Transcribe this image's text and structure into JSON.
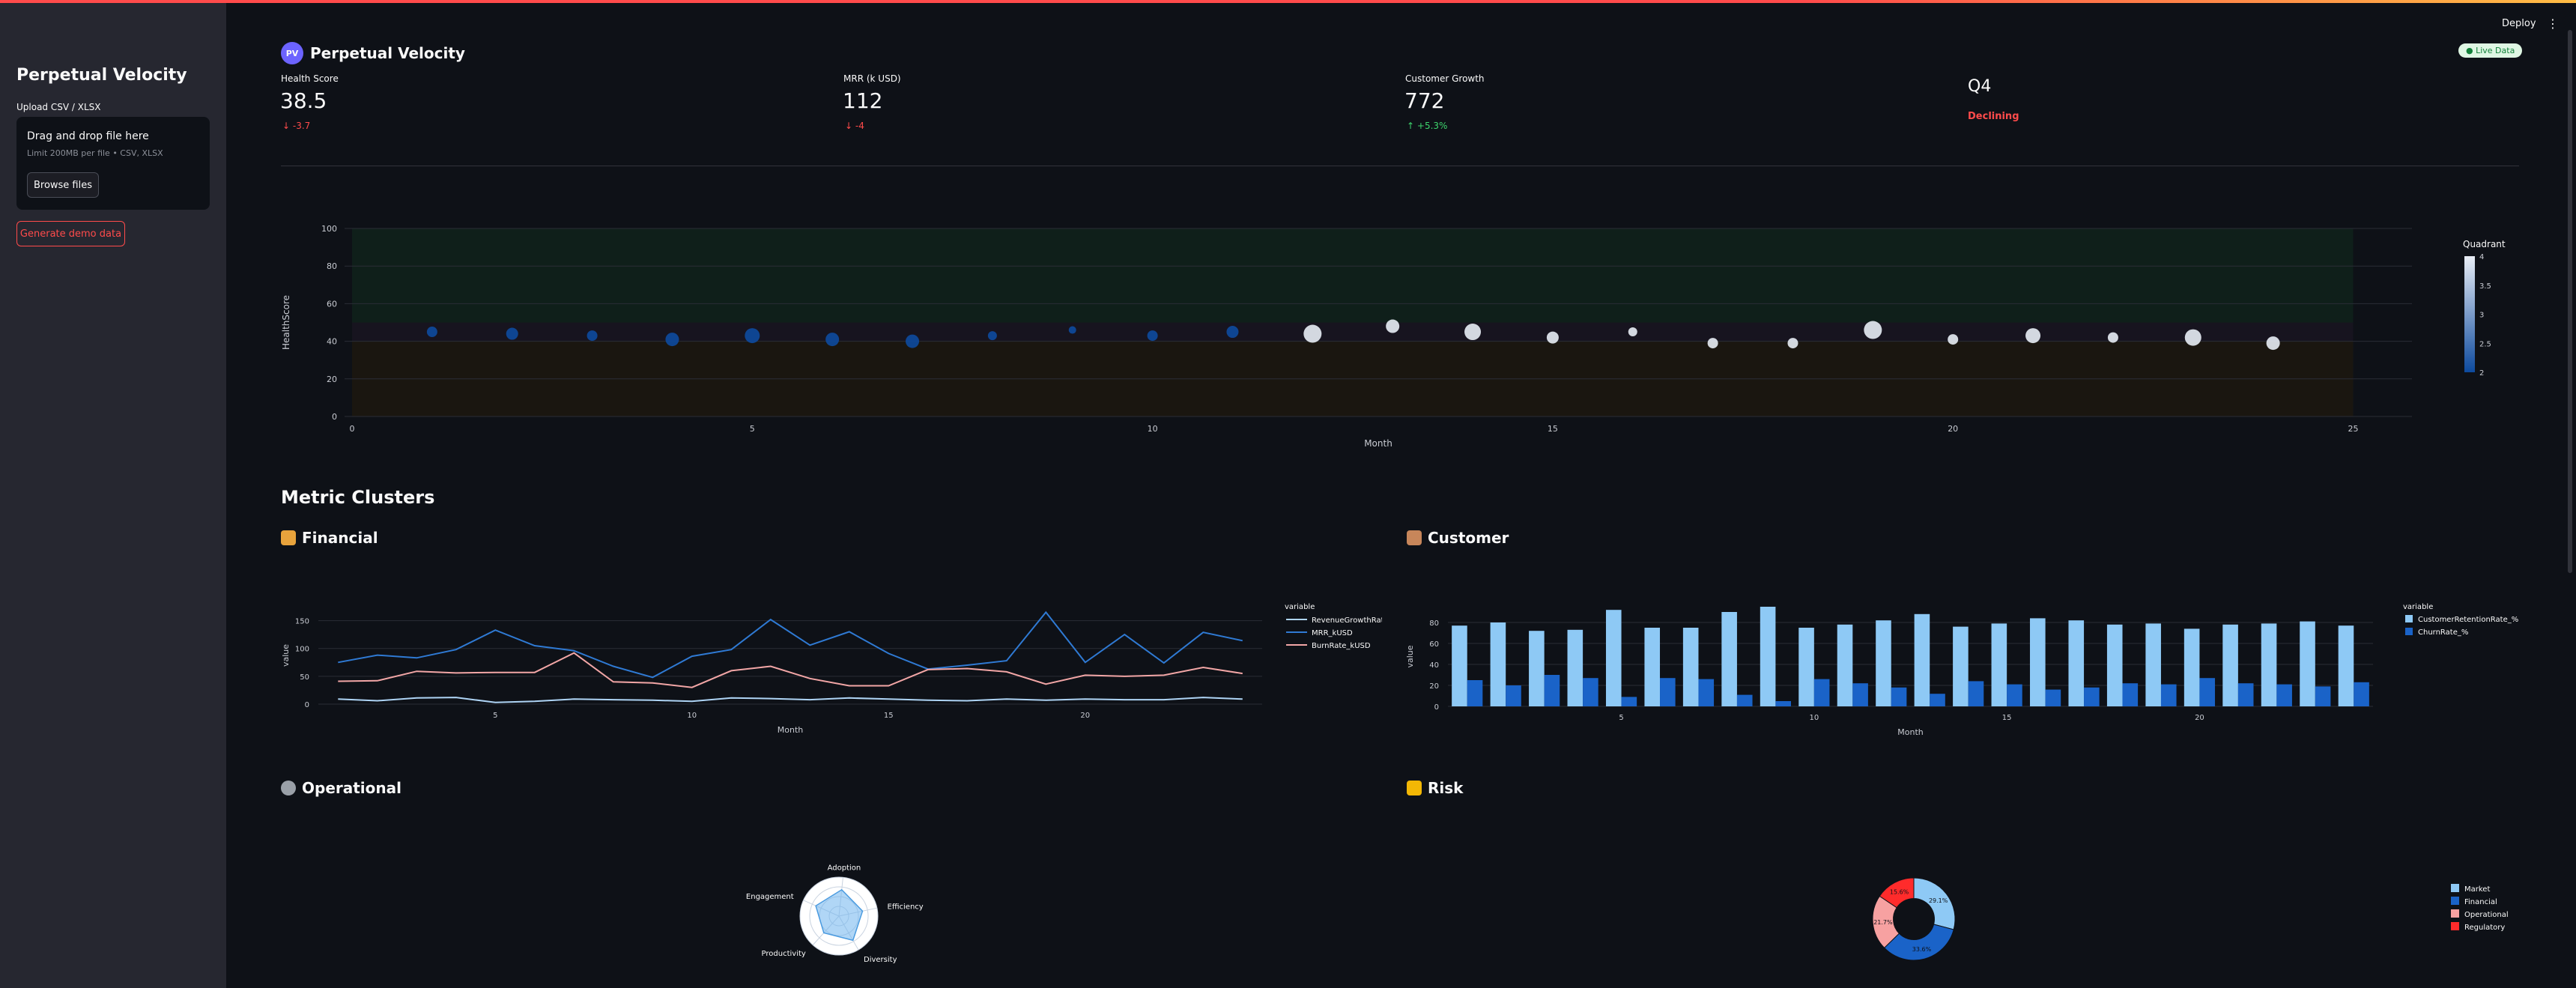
{
  "app": {
    "title": "Perpetual Velocity",
    "logo_text": "PV",
    "live_badge": "● Live Data",
    "deploy_label": "Deploy",
    "menu_icon": "kebab-menu-icon"
  },
  "sidebar": {
    "title": "Perpetual Velocity",
    "upload_label": "Upload CSV / XLSX",
    "drop_text": "Drag and drop file here",
    "limit_text": "Limit 200MB per file • CSV, XLSX",
    "browse_label": "Browse files",
    "demo_label": "Generate demo data"
  },
  "metrics": [
    {
      "label": "Health Score",
      "value": "38.5",
      "delta": "-3.7",
      "direction": "down"
    },
    {
      "label": "MRR (k USD)",
      "value": "112",
      "delta": "-4",
      "direction": "down"
    },
    {
      "label": "Customer Growth",
      "value": "772",
      "delta": "+5.3%",
      "direction": "up"
    },
    {
      "label": "",
      "value": "Q4",
      "delta": "Declining",
      "direction": "status"
    }
  ],
  "sections": {
    "clusters_title": "Metric Clusters",
    "financial": "Financial",
    "customer": "Customer",
    "operational": "Operational",
    "risk": "Risk"
  },
  "colors": {
    "accent": "#ff4b4b",
    "background": "#0e1117",
    "sidebar": "#262730",
    "scale_low": "#0d4a9e",
    "scale_high": "#e8edf5"
  },
  "chart_data": [
    {
      "id": "health",
      "type": "scatter",
      "xlabel": "Month",
      "ylabel": "HealthScore",
      "xlim": [
        0,
        25
      ],
      "ylim": [
        0,
        100
      ],
      "xticks": [
        0,
        5,
        10,
        15,
        20,
        25
      ],
      "yticks": [
        0,
        20,
        40,
        60,
        80,
        100
      ],
      "colorbar": {
        "title": "Quadrant",
        "ticks": [
          2,
          2.5,
          3,
          3.5,
          4
        ]
      },
      "points": [
        {
          "x": 1,
          "y": 45,
          "q": 2,
          "s": 7
        },
        {
          "x": 2,
          "y": 44,
          "q": 2,
          "s": 8
        },
        {
          "x": 3,
          "y": 43,
          "q": 2,
          "s": 7
        },
        {
          "x": 4,
          "y": 41,
          "q": 2,
          "s": 9
        },
        {
          "x": 5,
          "y": 43,
          "q": 2,
          "s": 10
        },
        {
          "x": 6,
          "y": 41,
          "q": 2,
          "s": 9
        },
        {
          "x": 7,
          "y": 40,
          "q": 2,
          "s": 9
        },
        {
          "x": 8,
          "y": 43,
          "q": 2,
          "s": 6
        },
        {
          "x": 9,
          "y": 46,
          "q": 2,
          "s": 5
        },
        {
          "x": 10,
          "y": 43,
          "q": 2,
          "s": 7
        },
        {
          "x": 11,
          "y": 45,
          "q": 2,
          "s": 8
        },
        {
          "x": 12,
          "y": 44,
          "q": 4,
          "s": 12
        },
        {
          "x": 13,
          "y": 48,
          "q": 4,
          "s": 9
        },
        {
          "x": 14,
          "y": 45,
          "q": 4,
          "s": 11
        },
        {
          "x": 15,
          "y": 42,
          "q": 4,
          "s": 8
        },
        {
          "x": 16,
          "y": 45,
          "q": 4,
          "s": 6
        },
        {
          "x": 17,
          "y": 39,
          "q": 4,
          "s": 7
        },
        {
          "x": 18,
          "y": 39,
          "q": 4,
          "s": 7
        },
        {
          "x": 19,
          "y": 46,
          "q": 4,
          "s": 12
        },
        {
          "x": 20,
          "y": 41,
          "q": 4,
          "s": 7
        },
        {
          "x": 21,
          "y": 43,
          "q": 4,
          "s": 10
        },
        {
          "x": 22,
          "y": 42,
          "q": 4,
          "s": 7
        },
        {
          "x": 23,
          "y": 42,
          "q": 4,
          "s": 11
        },
        {
          "x": 24,
          "y": 39,
          "q": 4,
          "s": 9
        }
      ]
    },
    {
      "id": "financial",
      "type": "line",
      "xlabel": "Month",
      "ylabel": "value",
      "legend_title": "variable",
      "xticks": [
        5,
        10,
        15,
        20
      ],
      "yticks": [
        0,
        50,
        100,
        150
      ],
      "x": [
        1,
        2,
        3,
        4,
        5,
        6,
        7,
        8,
        9,
        10,
        11,
        12,
        13,
        14,
        15,
        16,
        17,
        18,
        19,
        20,
        21,
        22,
        23,
        24
      ],
      "series": [
        {
          "name": "RevenueGrowthRate_%",
          "color": "#aed4f5",
          "values": [
            9,
            6,
            11,
            12,
            3,
            5,
            9,
            8,
            7,
            5,
            11,
            10,
            8,
            11,
            9,
            7,
            6,
            9,
            7,
            9,
            8,
            8,
            12,
            9
          ]
        },
        {
          "name": "MRR_kUSD",
          "color": "#2f7ad4",
          "values": [
            75,
            88,
            83,
            98,
            133,
            105,
            96,
            68,
            48,
            86,
            98,
            152,
            106,
            130,
            91,
            63,
            70,
            78,
            165,
            75,
            125,
            74,
            129,
            114
          ]
        },
        {
          "name": "BurnRate_kUSD",
          "color": "#f2a6a6",
          "values": [
            41,
            42,
            59,
            56,
            57,
            57,
            92,
            40,
            38,
            30,
            60,
            68,
            46,
            33,
            33,
            62,
            64,
            58,
            36,
            52,
            50,
            52,
            66,
            55
          ]
        }
      ]
    },
    {
      "id": "customer",
      "type": "bar",
      "xlabel": "Month",
      "ylabel": "value",
      "legend_title": "variable",
      "xticks": [
        5,
        10,
        15,
        20
      ],
      "yticks": [
        0,
        20,
        40,
        60,
        80
      ],
      "x": [
        1,
        2,
        3,
        4,
        5,
        6,
        7,
        8,
        9,
        10,
        11,
        12,
        13,
        14,
        15,
        16,
        17,
        18,
        19,
        20,
        21,
        22,
        23,
        24
      ],
      "series": [
        {
          "name": "CustomerRetentionRate_%",
          "color": "#8ec9f5",
          "values": [
            77,
            80,
            72,
            73,
            92,
            75,
            75,
            90,
            95,
            75,
            78,
            82,
            88,
            76,
            79,
            84,
            82,
            78,
            79,
            74,
            78,
            79,
            81,
            77
          ]
        },
        {
          "name": "ChurnRate_%",
          "color": "#1a63c8",
          "values": [
            25,
            20,
            30,
            27,
            9,
            27,
            26,
            11,
            5,
            26,
            22,
            18,
            12,
            24,
            21,
            16,
            18,
            22,
            21,
            27,
            22,
            21,
            19,
            23
          ]
        }
      ]
    },
    {
      "id": "operational",
      "type": "radar",
      "axes": [
        "Efficiency",
        "Diversity",
        "Productivity",
        "Engagement",
        "Adoption"
      ],
      "values": [
        0.62,
        0.72,
        0.58,
        0.65,
        0.68
      ]
    },
    {
      "id": "risk",
      "type": "pie",
      "hole": 0.5,
      "labels": [
        "Market",
        "Financial",
        "Operational",
        "Regulatory"
      ],
      "colors": [
        "#8ec9f5",
        "#1a63c8",
        "#f7a1a1",
        "#ff2b2b"
      ],
      "values": [
        29.1,
        33.6,
        21.7,
        15.6
      ],
      "value_labels": [
        "29.1%",
        "33.6%",
        "21.7%",
        "15.6%"
      ]
    }
  ]
}
